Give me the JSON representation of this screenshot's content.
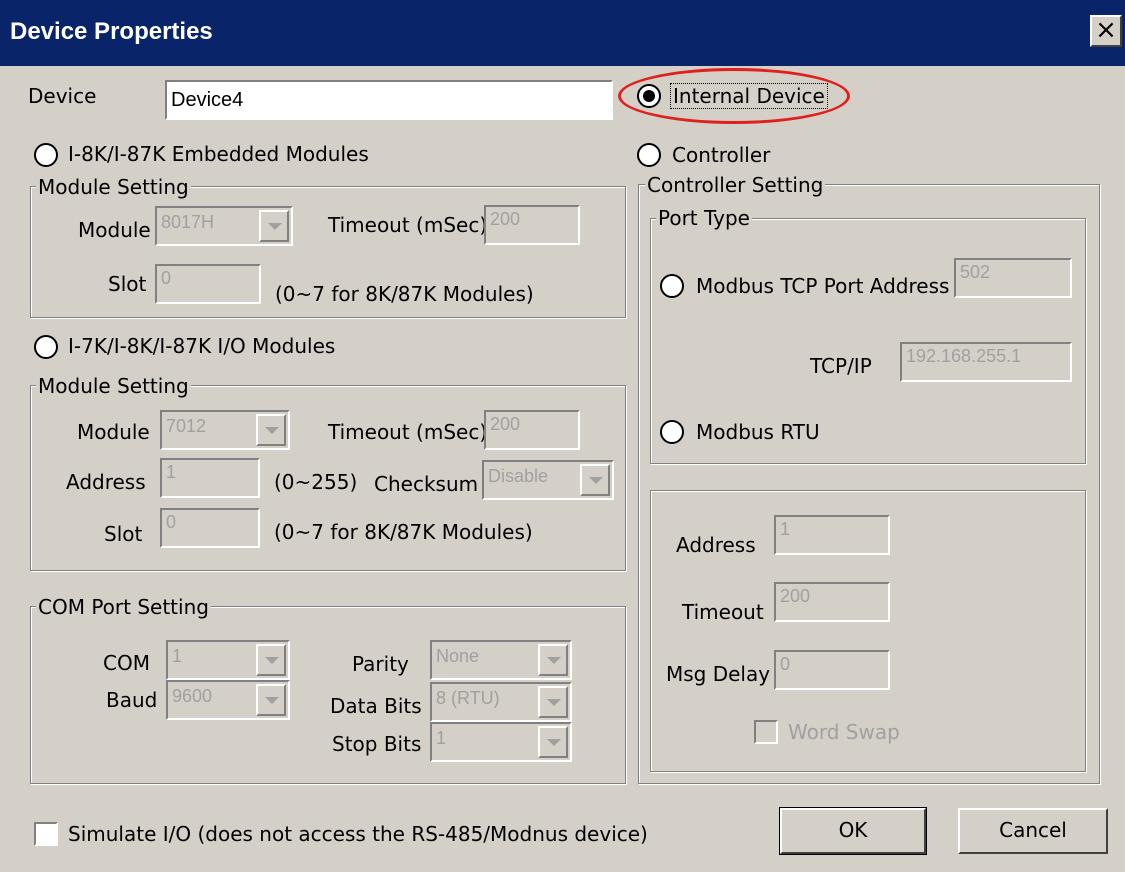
{
  "window": {
    "title": "Device Properties",
    "close_glyph": "×"
  },
  "device": {
    "label": "Device",
    "value": "Device4"
  },
  "device_type": {
    "internal_device": "Internal Device",
    "embedded_modules": "I-8K/I-87K Embedded Modules",
    "io_modules": "I-7K/I-8K/I-87K I/O Modules",
    "controller": "Controller",
    "selected": "internal_device"
  },
  "embedded_setting": {
    "group_title": "Module Setting",
    "module_label": "Module",
    "module_value": "8017H",
    "timeout_label": "Timeout (mSec)",
    "timeout_value": "200",
    "slot_label": "Slot",
    "slot_value": "0",
    "slot_hint": "(0~7 for 8K/87K Modules)"
  },
  "io_setting": {
    "group_title": "Module Setting",
    "module_label": "Module",
    "module_value": "7012",
    "timeout_label": "Timeout (mSec)",
    "timeout_value": "200",
    "address_label": "Address",
    "address_value": "1",
    "address_hint": "(0~255)",
    "checksum_label": "Checksum",
    "checksum_value": "Disable",
    "slot_label": "Slot",
    "slot_value": "0",
    "slot_hint": "(0~7 for 8K/87K Modules)"
  },
  "com_setting": {
    "group_title": "COM Port Setting",
    "com_label": "COM",
    "com_value": "1",
    "baud_label": "Baud",
    "baud_value": "9600",
    "parity_label": "Parity",
    "parity_value": "None",
    "databits_label": "Data Bits",
    "databits_value": "8 (RTU)",
    "stopbits_label": "Stop Bits",
    "stopbits_value": "1"
  },
  "controller_setting": {
    "group_title": "Controller Setting",
    "port_type_title": "Port Type",
    "tcp_label": "Modbus TCP Port Address",
    "tcp_port_value": "502",
    "tcpip_label": "TCP/IP",
    "tcpip_value": "192.168.255.1",
    "rtu_label": "Modbus RTU",
    "address_label": "Address",
    "address_value": "1",
    "timeout_label": "Timeout",
    "timeout_value": "200",
    "msgdelay_label": "Msg Delay",
    "msgdelay_value": "0",
    "wordswap_label": "Word Swap"
  },
  "simulate": {
    "label": "Simulate I/O (does not access the RS-485/Modnus device)"
  },
  "buttons": {
    "ok": "OK",
    "cancel": "Cancel"
  },
  "colors": {
    "titlebar": "#0a246a",
    "dialog_bg": "#d4d0c8",
    "highlight": "#e0201c"
  }
}
